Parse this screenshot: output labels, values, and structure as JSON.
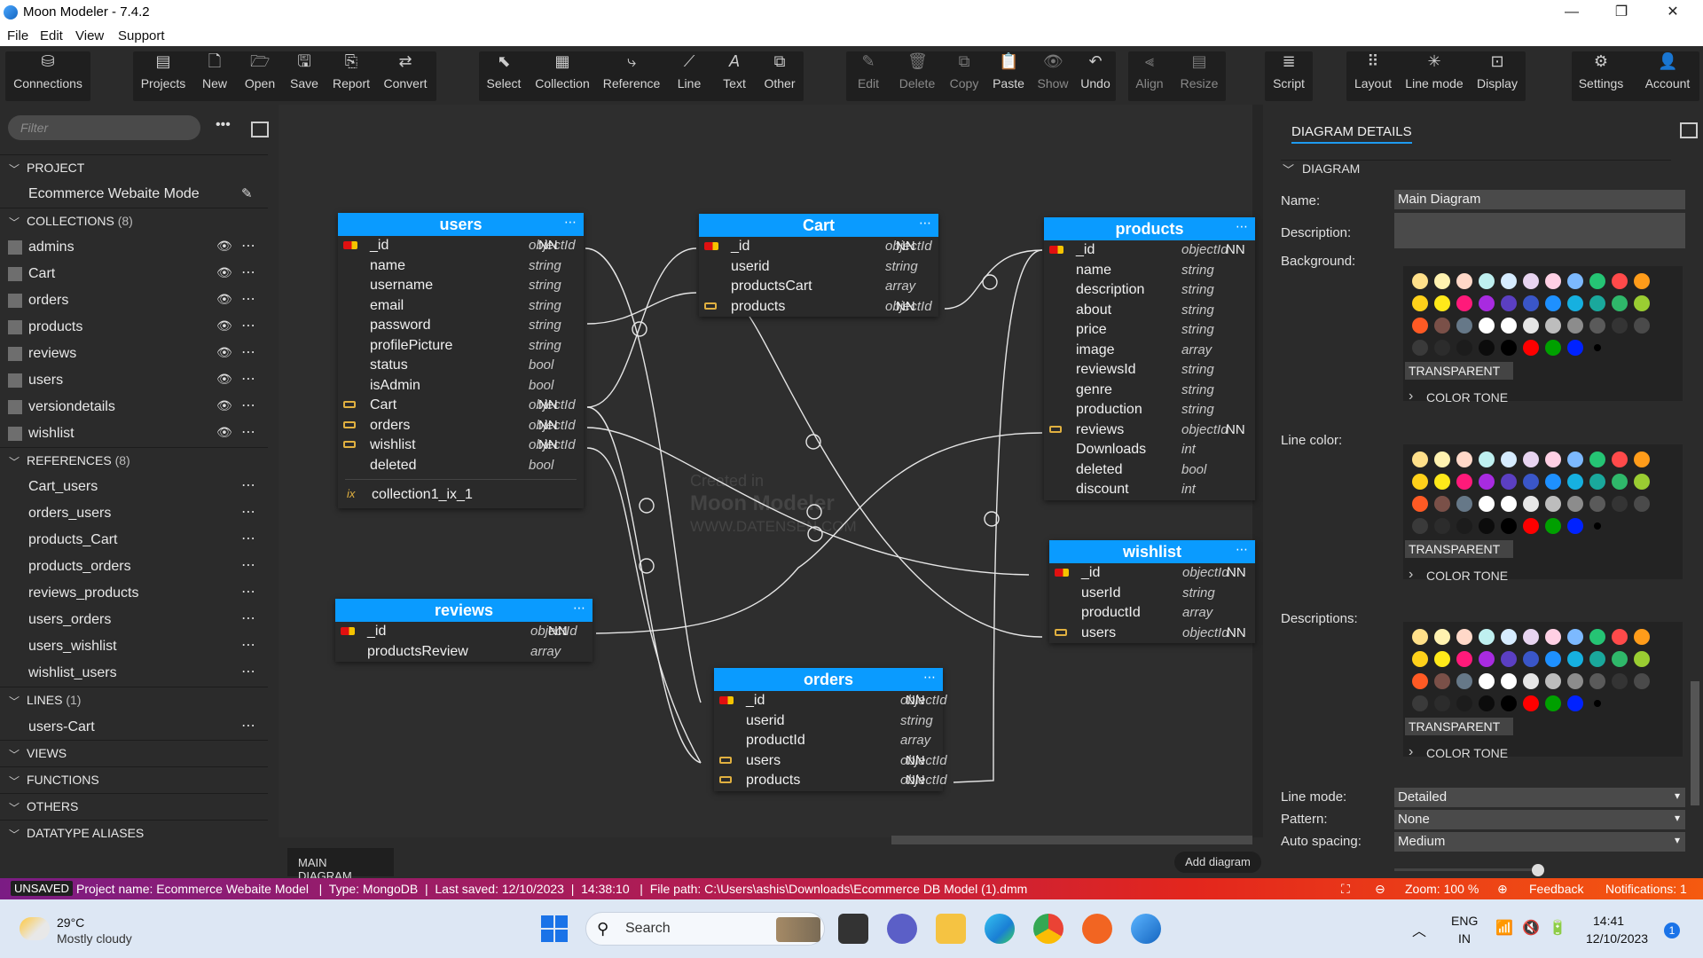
{
  "window": {
    "title": "Moon Modeler - 7.4.2",
    "minimize": "—",
    "restore": "❐",
    "close": "✕"
  },
  "menu": [
    "File",
    "Edit",
    "View",
    "Support"
  ],
  "toolbar": {
    "connections": "Connections",
    "projects": "Projects",
    "new": "New",
    "open": "Open",
    "save": "Save",
    "report": "Report",
    "convert": "Convert",
    "select": "Select",
    "collection": "Collection",
    "reference": "Reference",
    "line": "Line",
    "text": "Text",
    "other": "Other",
    "edit": "Edit",
    "delete": "Delete",
    "copy": "Copy",
    "paste": "Paste",
    "show": "Show",
    "undo": "Undo",
    "align": "Align",
    "resize": "Resize",
    "script": "Script",
    "layout": "Layout",
    "line_mode": "Line mode",
    "display": "Display",
    "settings": "Settings",
    "account": "Account"
  },
  "left": {
    "filter_placeholder": "Filter",
    "project_section": "PROJECT",
    "project_name": "Ecommerce Webaite Mode",
    "collections_section": "COLLECTIONS",
    "collections_count": "(8)",
    "collections": [
      "admins",
      "Cart",
      "orders",
      "products",
      "reviews",
      "users",
      "versiondetails",
      "wishlist"
    ],
    "references_section": "REFERENCES",
    "references_count": "(8)",
    "references": [
      "Cart_users",
      "orders_users",
      "products_Cart",
      "products_orders",
      "reviews_products",
      "users_orders",
      "users_wishlist",
      "wishlist_users"
    ],
    "lines_section": "LINES",
    "lines_count": "(1)",
    "lines": [
      "users-Cart"
    ],
    "views_section": "VIEWS",
    "functions_section": "FUNCTIONS",
    "others_section": "OTHERS",
    "datatype_section": "DATATYPE ALIASES"
  },
  "entities": {
    "users": {
      "name": "users",
      "rows": [
        {
          "key": "pk",
          "name": "_id",
          "type": "objectId",
          "nn": "NN"
        },
        {
          "key": "",
          "name": "name",
          "type": "string",
          "nn": ""
        },
        {
          "key": "",
          "name": "username",
          "type": "string",
          "nn": ""
        },
        {
          "key": "",
          "name": "email",
          "type": "string",
          "nn": ""
        },
        {
          "key": "",
          "name": "password",
          "type": "string",
          "nn": ""
        },
        {
          "key": "",
          "name": "profilePicture",
          "type": "string",
          "nn": ""
        },
        {
          "key": "",
          "name": "status",
          "type": "bool",
          "nn": ""
        },
        {
          "key": "",
          "name": "isAdmin",
          "type": "bool",
          "nn": ""
        },
        {
          "key": "fk",
          "name": "Cart",
          "type": "objectId",
          "nn": "NN"
        },
        {
          "key": "fk",
          "name": "orders",
          "type": "objectId",
          "nn": "NN"
        },
        {
          "key": "fk",
          "name": "wishlist",
          "type": "objectId",
          "nn": "NN"
        },
        {
          "key": "",
          "name": "deleted",
          "type": "bool",
          "nn": ""
        }
      ],
      "index": "collection1_ix_1",
      "index_icon": "ix"
    },
    "cart": {
      "name": "Cart",
      "rows": [
        {
          "key": "pk",
          "name": "_id",
          "type": "objectId",
          "nn": "NN"
        },
        {
          "key": "",
          "name": "userid",
          "type": "string",
          "nn": ""
        },
        {
          "key": "",
          "name": "productsCart",
          "type": "array",
          "nn": ""
        },
        {
          "key": "fk",
          "name": "products",
          "type": "objectId",
          "nn": "NN"
        }
      ]
    },
    "products": {
      "name": "products",
      "rows": [
        {
          "key": "pk",
          "name": "_id",
          "type": "objectId",
          "nn": "NN"
        },
        {
          "key": "",
          "name": "name",
          "type": "string",
          "nn": ""
        },
        {
          "key": "",
          "name": "description",
          "type": "string",
          "nn": ""
        },
        {
          "key": "",
          "name": "about",
          "type": "string",
          "nn": ""
        },
        {
          "key": "",
          "name": "price",
          "type": "string",
          "nn": ""
        },
        {
          "key": "",
          "name": "image",
          "type": "array",
          "nn": ""
        },
        {
          "key": "",
          "name": "reviewsId",
          "type": "string",
          "nn": ""
        },
        {
          "key": "",
          "name": "genre",
          "type": "string",
          "nn": ""
        },
        {
          "key": "",
          "name": "production",
          "type": "string",
          "nn": ""
        },
        {
          "key": "fk",
          "name": "reviews",
          "type": "objectId",
          "nn": "NN"
        },
        {
          "key": "",
          "name": "Downloads",
          "type": "int",
          "nn": ""
        },
        {
          "key": "",
          "name": "deleted",
          "type": "bool",
          "nn": ""
        },
        {
          "key": "",
          "name": "discount",
          "type": "int",
          "nn": ""
        }
      ]
    },
    "wishlist": {
      "name": "wishlist",
      "rows": [
        {
          "key": "pk",
          "name": "_id",
          "type": "objectId",
          "nn": "NN"
        },
        {
          "key": "",
          "name": "userId",
          "type": "string",
          "nn": ""
        },
        {
          "key": "",
          "name": "productId",
          "type": "array",
          "nn": ""
        },
        {
          "key": "fk",
          "name": "users",
          "type": "objectId",
          "nn": "NN"
        }
      ]
    },
    "reviews": {
      "name": "reviews",
      "rows": [
        {
          "key": "pk",
          "name": "_id",
          "type": "objectId",
          "nn": "NN"
        },
        {
          "key": "",
          "name": "productsReview",
          "type": "array",
          "nn": ""
        }
      ]
    },
    "orders": {
      "name": "orders",
      "rows": [
        {
          "key": "pk",
          "name": "_id",
          "type": "objectId",
          "nn": "NN"
        },
        {
          "key": "",
          "name": "userid",
          "type": "string",
          "nn": ""
        },
        {
          "key": "",
          "name": "productId",
          "type": "array",
          "nn": ""
        },
        {
          "key": "fk",
          "name": "users",
          "type": "objectId",
          "nn": "NN"
        },
        {
          "key": "fk",
          "name": "products",
          "type": "objectId",
          "nn": "NN"
        }
      ]
    }
  },
  "watermark": {
    "line1": "Created in",
    "line2": "Moon Modeler",
    "line3": "WWW.DATENSEN.COM"
  },
  "tabs": {
    "main": "MAIN DIAGRAM",
    "add": "Add diagram"
  },
  "right": {
    "tab": "DIAGRAM DETAILS",
    "section": "DIAGRAM",
    "name_label": "Name:",
    "name_value": "Main Diagram",
    "description_label": "Description:",
    "background_label": "Background:",
    "line_color_label": "Line color:",
    "descriptions_label": "Descriptions:",
    "transparent": "TRANSPARENT",
    "color_tone": "COLOR TONE",
    "line_mode_label": "Line mode:",
    "line_mode_value": "Detailed",
    "pattern_label": "Pattern:",
    "pattern_value": "None",
    "auto_spacing_label": "Auto spacing:",
    "auto_spacing_value": "Medium",
    "swatches": [
      "#ffe08a",
      "#fff2b0",
      "#ffd8c8",
      "#bff0f0",
      "#d6ecff",
      "#e8d4f0",
      "#ffd0e4",
      "#7cb9ff",
      "#25c474",
      "#ff4a4a",
      "#ff9c1a",
      "#ffd11a",
      "#ffe91a",
      "#ff1a7a",
      "#a82be0",
      "#5b3fc2",
      "#3a56c8",
      "#1e90ff",
      "#16b0e0",
      "#1aa89c",
      "#2fb86a",
      "#9acd32",
      "#ff5a24",
      "#7a5048",
      "#667888",
      "#ffffff",
      "#ffffff",
      "#e6e6e6",
      "#bdbdbd",
      "#8c8c8c",
      "#5a5a5a",
      "#343434",
      "#4a4a4a",
      "#3a3a3a",
      "#2c2c2c",
      "#1c1c1c",
      "#0c0c0c",
      "#000000",
      "#ff0000",
      "#00a000",
      "#0022ff",
      "#000000"
    ]
  },
  "status": {
    "unsaved": "UNSAVED",
    "info": "Project name: Ecommerce Webaite Model   |  Type: MongoDB  |  Last saved: 12/10/2023  |  14:38:10   |  File path: C:\\Users\\ashis\\Downloads\\Ecommerce DB Model (1).dmm",
    "zoom": "Zoom: 100 %",
    "feedback": "Feedback",
    "notifications": "Notifications: 1"
  },
  "taskbar": {
    "temp": "29°C",
    "weather": "Mostly cloudy",
    "search": "Search",
    "lang1": "ENG",
    "lang2": "IN",
    "time": "14:41",
    "date": "12/10/2023",
    "badge": "1"
  }
}
